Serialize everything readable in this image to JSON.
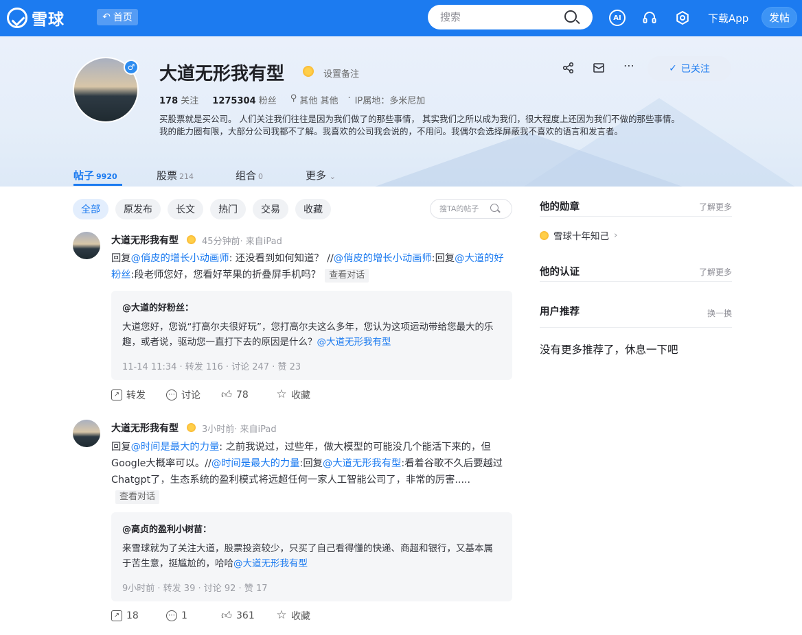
{
  "header": {
    "logo_text": "雪球",
    "home_label": "首页",
    "search_placeholder": "搜索",
    "ai_label": "AI",
    "download_label": "下载App",
    "post_label": "发帖"
  },
  "profile": {
    "name": "大道无形我有型",
    "set_note": "设置备注",
    "following_count": "178",
    "following_label": "关注",
    "followers_count": "1275304",
    "followers_label": "粉丝",
    "location": "其他 其他",
    "ip_label": "IP属地：",
    "ip_value": "多米尼加",
    "bio": "买股票就是买公司。 人们关注我们往往是因为我们做了的那些事情， 其实我们之所以成为我们，很大程度上还因为我们不做的那些事情。 我的能力圈有限，大部分公司我都不了解。我喜欢的公司我会说的，不用问。我偶尔会选择屏蔽我不喜欢的语言和发言者。",
    "followed_label": "已关注"
  },
  "tabs": [
    {
      "label": "帖子",
      "count": "9920"
    },
    {
      "label": "股票",
      "count": "214"
    },
    {
      "label": "组合",
      "count": "0"
    },
    {
      "label": "更多",
      "count": ""
    }
  ],
  "filters": [
    "全部",
    "原发布",
    "长文",
    "热门",
    "交易",
    "收藏"
  ],
  "ta_search_placeholder": "搜TA的帖子",
  "posts": [
    {
      "author": "大道无形我有型",
      "meta": "45分钟前· 来自iPad",
      "t1": "回复",
      "m1": "@俏皮的增长小动画师",
      "t2": ": 还没看到如何知道？ //",
      "m2": "@俏皮的增长小动画师",
      "t3": ":回复",
      "m3": "@大道的好粉丝",
      "t4": ":段老师您好，您看好苹果的折叠屏手机吗？",
      "view_conv": "查看对话",
      "quote_name": "@大道的好粉丝：",
      "quote_text": "大道您好，您说“打高尔夫很好玩”，您打高尔夫这么多年，您认为这项运动带给您最大的乐趣，或者说，驱动您一直打下去的原因是什么？",
      "quote_mention": "@大道无形我有型",
      "quote_meta": "11-14 11:34  · 转发 116 · 讨论 247 · 赞 23",
      "repost": "转发",
      "comment": "讨论",
      "likes": "78",
      "fav": "收藏"
    },
    {
      "author": "大道无形我有型",
      "meta": "3小时前· 来自iPad",
      "t1": "回复",
      "m1": "@时间是最大的力量",
      "t2": ": 之前我说过，过些年，做大模型的可能没几个能活下来的，但Google大概率可以。//",
      "m2": "@时间是最大的力量",
      "t3": ":回复",
      "m3": "@大道无形我有型",
      "t4": ":看着谷歌不久后要越过Chatgpt了，生态系统的盈利模式将远超任何一家人工智能公司了，非常的厉害.....",
      "view_conv": "查看对话",
      "quote_name": "@高贞的盈利小树苗：",
      "quote_text": "来雪球就为了关注大道，股票投资较少，只买了自己看得懂的快递、商超和银行，又基本属于苦生意，挺尴尬的，哈哈",
      "quote_mention": "@大道无形我有型",
      "quote_meta": "9小时前  · 转发 39 · 讨论 92 · 赞 17",
      "repost": "18",
      "comment": "1",
      "likes": "361",
      "fav": "收藏"
    }
  ],
  "sidebar": {
    "medals_title": "他的勋章",
    "learn_more": "了解更多",
    "medal_name": "雪球十年知己",
    "cert_title": "他的认证",
    "cert_more": "了解更多",
    "rec_title": "用户推荐",
    "rec_refresh": "换一换",
    "rec_empty": "没有更多推荐了，休息一下吧"
  }
}
